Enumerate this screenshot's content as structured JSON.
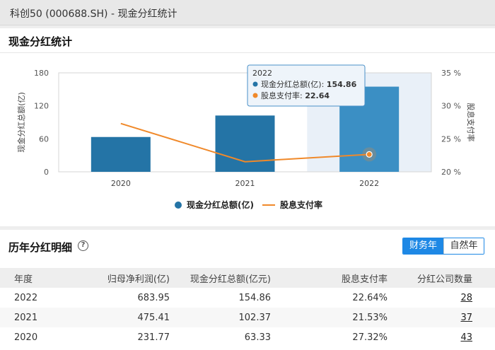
{
  "page_title": "科创50 (000688.SH) - 现金分红统计",
  "chart_section": {
    "title": "现金分红统计"
  },
  "chart_data": {
    "type": "bar",
    "categories": [
      "2020",
      "2021",
      "2022"
    ],
    "series": [
      {
        "name": "现金分红总额(亿)",
        "type": "bar",
        "axis": "left",
        "values": [
          63.33,
          102.37,
          154.86
        ],
        "color": "#2474a6"
      },
      {
        "name": "股息支付率",
        "type": "line",
        "axis": "right",
        "values": [
          27.32,
          21.53,
          22.64
        ],
        "color": "#f0892a"
      }
    ],
    "ylabel_left": "现金分红总额(亿)",
    "ylabel_right": "股息支付率",
    "ylim_left": [
      0,
      180
    ],
    "yticks_left": [
      "0",
      "60",
      "120",
      "180"
    ],
    "ylim_right": [
      20,
      35
    ],
    "yticks_right": [
      "20 %",
      "25 %",
      "30 %",
      "35 %"
    ],
    "grid": false,
    "legend": "bottom",
    "highlighted_category": "2022",
    "tooltip": {
      "title": "2022",
      "rows": [
        {
          "label": "现金分红总额(亿): ",
          "value": "154.86",
          "color": "#2474a6"
        },
        {
          "label": "股息支付率: ",
          "value": "22.64",
          "color": "#f0892a"
        }
      ]
    }
  },
  "table_section": {
    "title": "历年分红明细",
    "help_icon": "question-circle-icon",
    "toggle": {
      "options": [
        "财务年",
        "自然年"
      ],
      "selected": "财务年"
    },
    "columns": [
      "年度",
      "归母净利润(亿)",
      "现金分红总额(亿元)",
      "股息支付率",
      "分红公司数量"
    ],
    "rows": [
      [
        "2022",
        "683.95",
        "154.86",
        "22.64%",
        "28"
      ],
      [
        "2021",
        "475.41",
        "102.37",
        "21.53%",
        "37"
      ],
      [
        "2020",
        "231.77",
        "63.33",
        "27.32%",
        "43"
      ]
    ]
  }
}
